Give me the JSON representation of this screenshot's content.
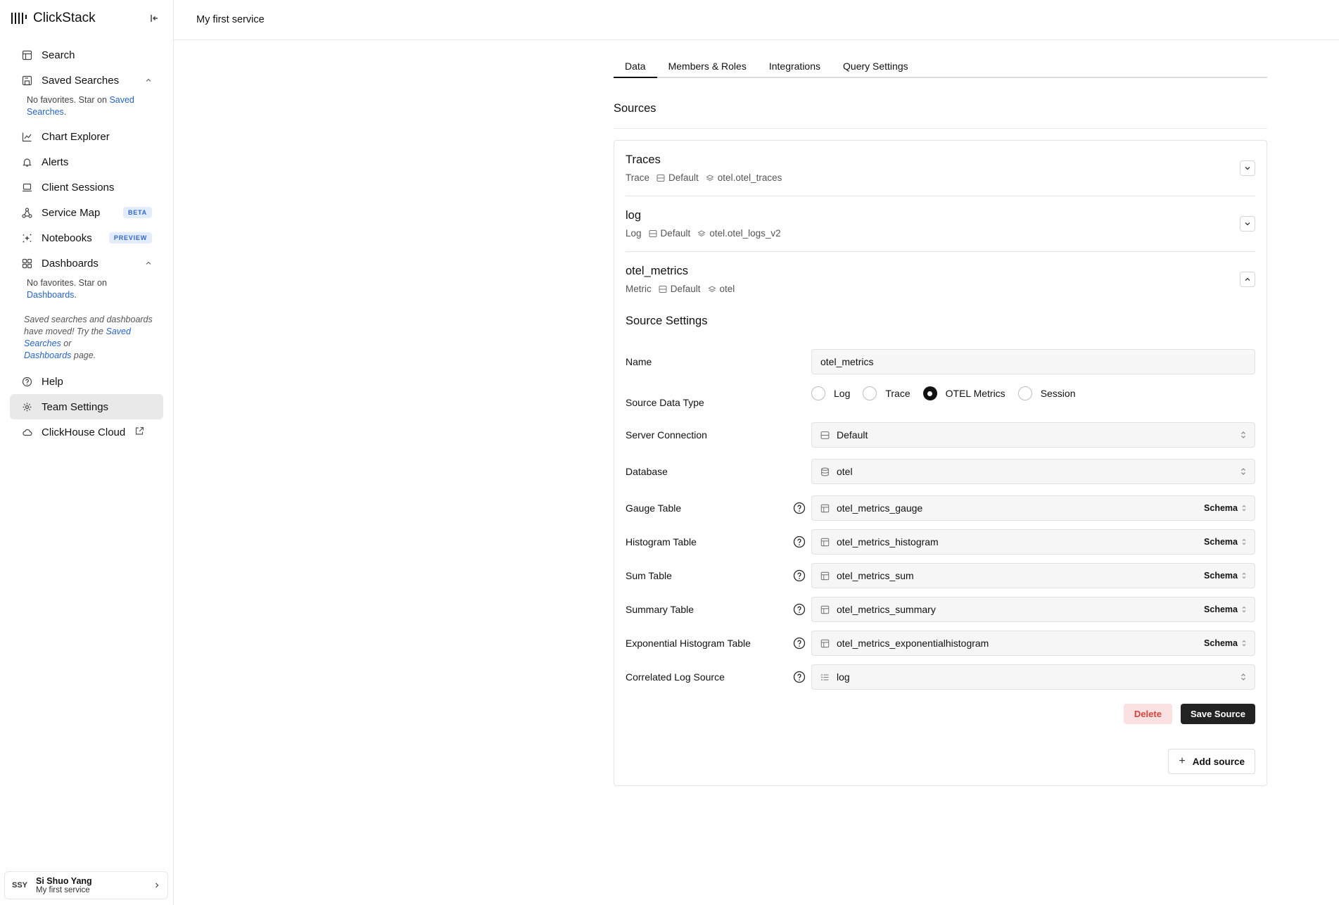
{
  "brand": {
    "name": "ClickStack"
  },
  "sidebar": {
    "items": [
      {
        "label": "Search"
      },
      {
        "label": "Saved Searches"
      },
      {
        "label": "Chart Explorer"
      },
      {
        "label": "Alerts"
      },
      {
        "label": "Client Sessions"
      },
      {
        "label": "Service Map",
        "badge": "BETA"
      },
      {
        "label": "Notebooks",
        "badge": "PREVIEW"
      },
      {
        "label": "Dashboards"
      },
      {
        "label": "Help"
      },
      {
        "label": "Team Settings"
      },
      {
        "label": "ClickHouse Cloud"
      }
    ],
    "saved_fav_note": "No favorites. Star on",
    "saved_fav_link": "Saved Searches",
    "dash_fav_note": "No favorites. Star on",
    "dash_fav_link": "Dashboards",
    "moved_note_prefix": "Saved searches and dashboards have moved! Try the",
    "moved_link1": "Saved Searches",
    "moved_or": "or",
    "moved_link2": "Dashboards",
    "moved_suffix": "page."
  },
  "user": {
    "initials": "SSY",
    "name": "Si Shuo Yang",
    "service": "My first service"
  },
  "topbar": {
    "title": "My first service"
  },
  "tabs": [
    "Data",
    "Members & Roles",
    "Integrations",
    "Query Settings"
  ],
  "sources_title": "Sources",
  "sources": [
    {
      "name": "Traces",
      "kind": "Trace",
      "connection": "Default",
      "table": "otel.otel_traces"
    },
    {
      "name": "log",
      "kind": "Log",
      "connection": "Default",
      "table": "otel.otel_logs_v2"
    },
    {
      "name": "otel_metrics",
      "kind": "Metric",
      "connection": "Default",
      "table": "otel"
    }
  ],
  "settings": {
    "title": "Source Settings",
    "name_label": "Name",
    "name_value": "otel_metrics",
    "type_label": "Source Data Type",
    "type_options": [
      "Log",
      "Trace",
      "OTEL Metrics",
      "Session"
    ],
    "type_selected": "OTEL Metrics",
    "server_label": "Server Connection",
    "server_value": "Default",
    "db_label": "Database",
    "db_value": "otel",
    "schema_label": "Schema",
    "tables": [
      {
        "label": "Gauge Table",
        "value": "otel_metrics_gauge"
      },
      {
        "label": "Histogram Table",
        "value": "otel_metrics_histogram"
      },
      {
        "label": "Sum Table",
        "value": "otel_metrics_sum"
      },
      {
        "label": "Summary Table",
        "value": "otel_metrics_summary"
      },
      {
        "label": "Exponential Histogram Table",
        "value": "otel_metrics_exponentialhistogram"
      }
    ],
    "log_source_label": "Correlated Log Source",
    "log_source_value": "log",
    "delete_label": "Delete",
    "save_label": "Save Source"
  },
  "add_source_label": "Add source"
}
